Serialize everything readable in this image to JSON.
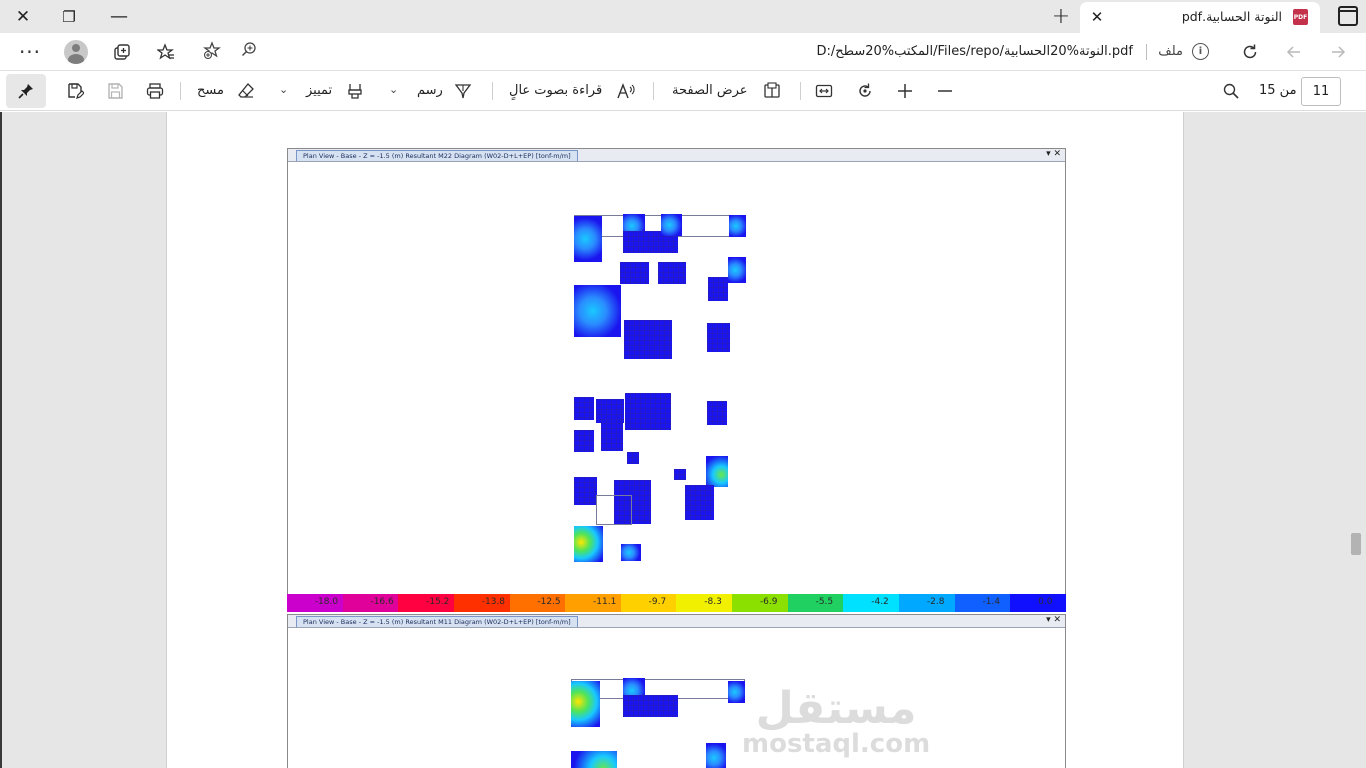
{
  "window": {
    "close": "✕",
    "restore": "❐",
    "minimize": "—"
  },
  "tab": {
    "title": "النوتة الحسابية.pdf",
    "close": "✕",
    "new": "+",
    "icon": "PDF"
  },
  "addressbar": {
    "more": "···",
    "url": "D:/المكتب%20سطح/Files/repo/النوتة%20الحسابية.pdf",
    "file_label": "ملف",
    "info": "i"
  },
  "pdf_toolbar": {
    "erase": "مسح",
    "highlight": "تمييز",
    "draw": "رسم",
    "read_aloud": "قراءة بصوت عالٍ",
    "page_view": "عرض الصفحة",
    "page_of": "من 15",
    "page_number": "11"
  },
  "figure1": {
    "title": "Plan View - Base - Z = -1.5 (m)    Resultant M22 Diagram    (W02-D+L+EP)  [tonf-m/m]"
  },
  "figure2": {
    "title": "Plan View - Base - Z = -1.5 (m)    Resultant M11 Diagram    (W02-D+L+EP)  [tonf-m/m]"
  },
  "legend": {
    "labels": [
      "-18.0",
      "-16.6",
      "-15.2",
      "-13.8",
      "-12.5",
      "-11.1",
      "-9.7",
      "-8.3",
      "-6.9",
      "-5.5",
      "-4.2",
      "-2.8",
      "-1.4",
      "0.0"
    ],
    "colors": [
      "#cc00cc",
      "#e0009a",
      "#ff0040",
      "#ff3000",
      "#ff7000",
      "#ffa000",
      "#ffd000",
      "#f0f000",
      "#8ce000",
      "#20d060",
      "#00e0ff",
      "#00a8ff",
      "#1060ff",
      "#1010ff"
    ]
  },
  "watermark": {
    "arabic": "مستقل",
    "latin": "mostaql.com"
  },
  "icons": {
    "collections": "collections-icon",
    "favorites": "favorites-icon",
    "refresh": "refresh-icon",
    "back": "back-icon",
    "forward": "forward-icon",
    "search": "search-icon",
    "zoom_in": "zoom-in-icon",
    "zoom_out": "zoom-out-icon",
    "rotate": "rotate-icon",
    "fit": "fit-width-icon",
    "print": "print-icon",
    "save": "save-icon",
    "save_as": "save-as-icon",
    "pin": "pin-icon"
  }
}
